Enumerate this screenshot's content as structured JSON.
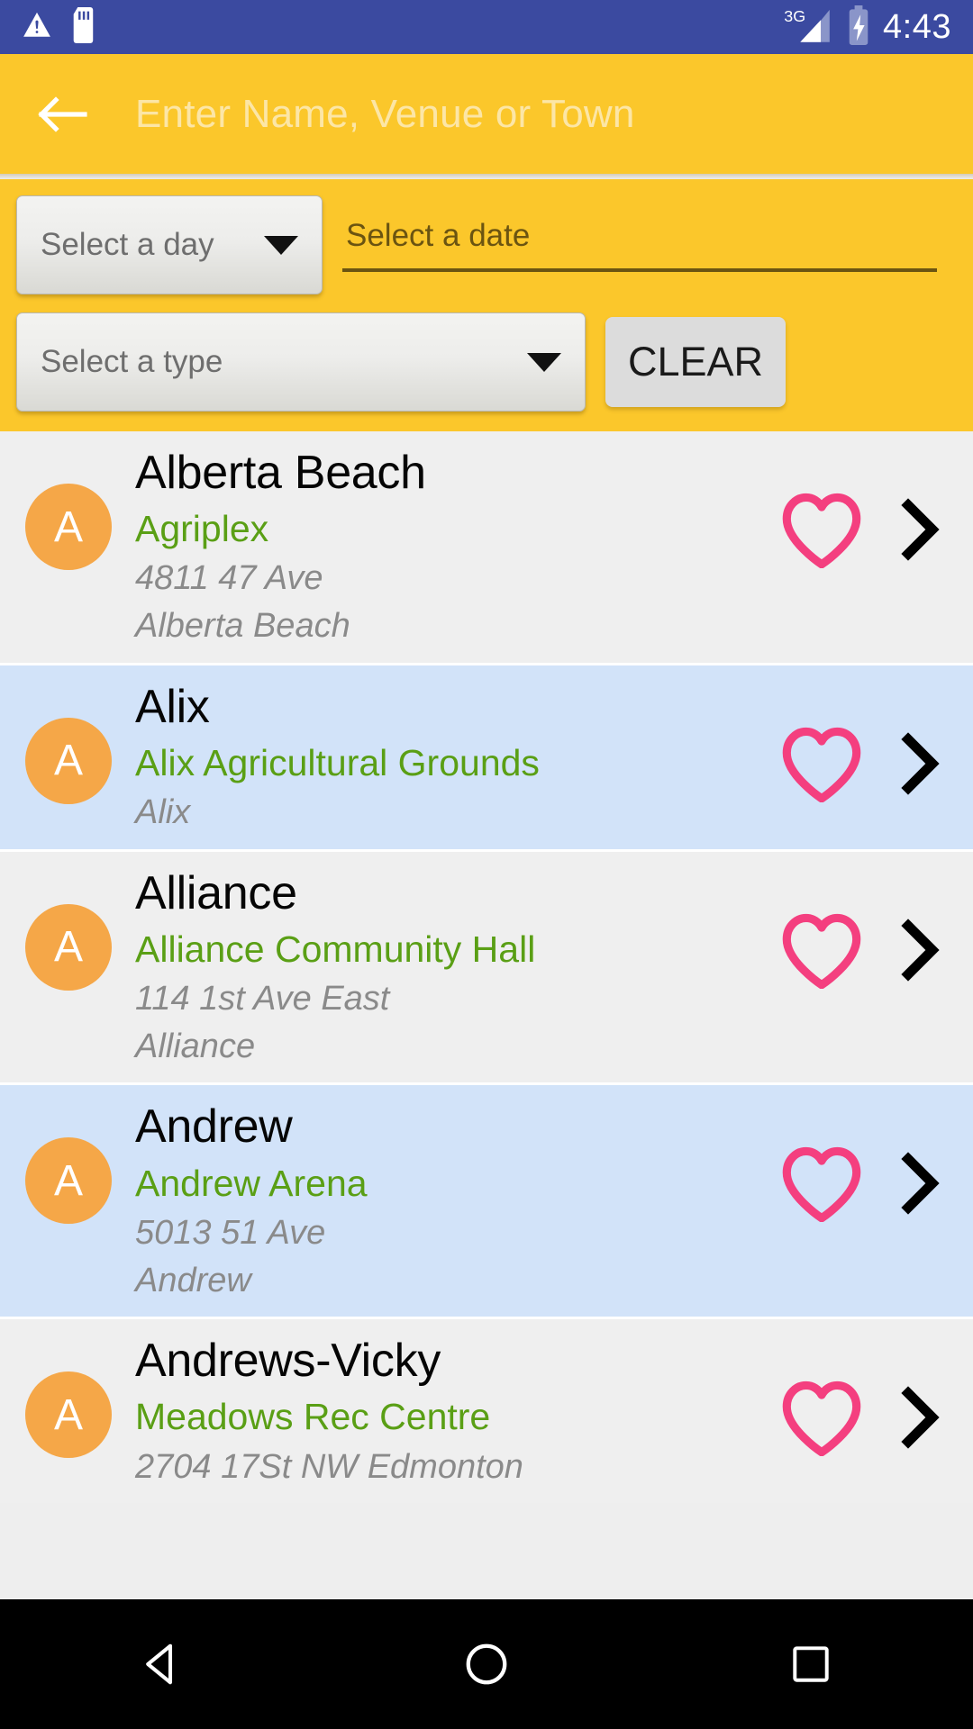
{
  "status_bar": {
    "time": "4:43",
    "icons": [
      "warning-triangle-icon",
      "sd-card-icon",
      "signal-3g-icon",
      "battery-charging-icon"
    ],
    "network_label": "3G",
    "background": "#3B4AA0"
  },
  "toolbar": {
    "back_icon": "back-arrow-icon",
    "search_placeholder": "Enter Name, Venue or Town",
    "search_value": "",
    "background": "#FBC72B"
  },
  "filters": {
    "day_spinner": {
      "label": "Select a day",
      "icon": "chevron-down-icon"
    },
    "date_field": {
      "placeholder": "Select a date",
      "value": ""
    },
    "type_spinner": {
      "label": "Select a type",
      "icon": "chevron-down-icon"
    },
    "clear_button": {
      "label": "CLEAR"
    }
  },
  "list": {
    "favorite_icon": "heart-outline-icon",
    "disclosure_icon": "chevron-right-icon",
    "accent_colors": {
      "avatar": "#F5A748",
      "venue_text": "#5A9F15",
      "heart": "#F43F7F",
      "row_alt_background": "#D2E3F9",
      "row_background": "#EFEFEF"
    },
    "items": [
      {
        "avatar_letter": "A",
        "title": "Alberta Beach",
        "venue": "Agriplex",
        "address_line1": "4811 47 Ave",
        "address_line2": "Alberta Beach"
      },
      {
        "avatar_letter": "A",
        "title": "Alix",
        "venue": "Alix Agricultural Grounds",
        "address_line1": "Alix",
        "address_line2": ""
      },
      {
        "avatar_letter": "A",
        "title": "Alliance",
        "venue": "Alliance Community Hall",
        "address_line1": "114 1st Ave East",
        "address_line2": "Alliance"
      },
      {
        "avatar_letter": "A",
        "title": "Andrew",
        "venue": "Andrew Arena",
        "address_line1": "5013 51 Ave",
        "address_line2": "Andrew"
      },
      {
        "avatar_letter": "A",
        "title": "Andrews-Vicky",
        "venue": "Meadows Rec Centre",
        "address_line1": "2704 17St NW Edmonton",
        "address_line2": ""
      }
    ]
  },
  "navbar": {
    "back": "nav-back-triangle-icon",
    "home": "nav-home-circle-icon",
    "recents": "nav-recents-square-icon"
  }
}
